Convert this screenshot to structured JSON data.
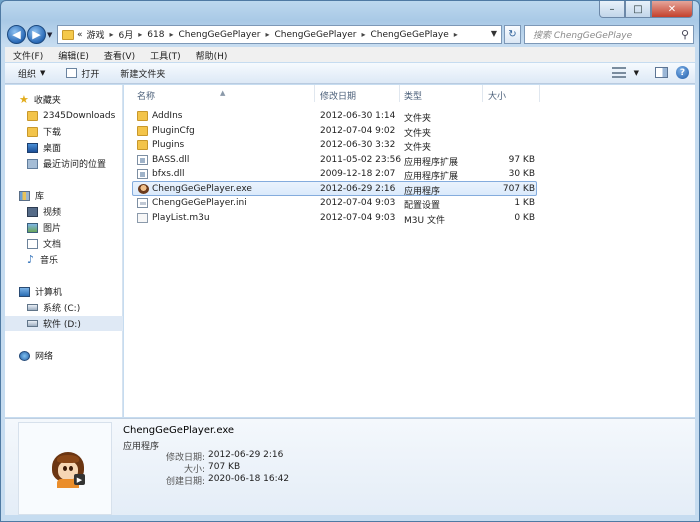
{
  "window": {
    "controls": {
      "minimize": "–",
      "maximize": "□",
      "close": "✕"
    }
  },
  "address": {
    "prefix": "«",
    "crumbs": [
      "游戏",
      "6月",
      "618",
      "ChengGeGePlayer",
      "ChengGeGePlayer",
      "ChengGeGePlaye"
    ],
    "search_placeholder": "搜索 ChengGeGePlaye"
  },
  "menu": [
    "文件(F)",
    "编辑(E)",
    "查看(V)",
    "工具(T)",
    "帮助(H)"
  ],
  "toolbar": {
    "organize": "组织",
    "open": "打开",
    "new_folder": "新建文件夹"
  },
  "nav": {
    "favorites": "收藏夹",
    "fav_items": [
      "2345Downloads",
      "下载",
      "桌面",
      "最近访问的位置"
    ],
    "libraries": "库",
    "lib_items": [
      "视频",
      "图片",
      "文档",
      "音乐"
    ],
    "computer": "计算机",
    "drives": [
      "系统 (C:)",
      "软件 (D:)"
    ],
    "network": "网络"
  },
  "columns": {
    "name": "名称",
    "modified": "修改日期",
    "type": "类型",
    "size": "大小"
  },
  "files": [
    {
      "name": "AddIns",
      "modified": "2012-06-30 1:14",
      "type": "文件夹",
      "size": "",
      "icon": "folder-icon"
    },
    {
      "name": "PluginCfg",
      "modified": "2012-07-04 9:02",
      "type": "文件夹",
      "size": "",
      "icon": "folder-icon"
    },
    {
      "name": "Plugins",
      "modified": "2012-06-30 3:32",
      "type": "文件夹",
      "size": "",
      "icon": "folder-icon"
    },
    {
      "name": "BASS.dll",
      "modified": "2011-05-02 23:56",
      "type": "应用程序扩展",
      "size": "97 KB",
      "icon": "dll-icon"
    },
    {
      "name": "bfxs.dll",
      "modified": "2009-12-18 2:07",
      "type": "应用程序扩展",
      "size": "30 KB",
      "icon": "dll-icon"
    },
    {
      "name": "ChengGeGePlayer.exe",
      "modified": "2012-06-29 2:16",
      "type": "应用程序",
      "size": "707 KB",
      "icon": "exe-icon"
    },
    {
      "name": "ChengGeGePlayer.ini",
      "modified": "2012-07-04 9:03",
      "type": "配置设置",
      "size": "1 KB",
      "icon": "ini-icon"
    },
    {
      "name": "PlayList.m3u",
      "modified": "2012-07-04 9:03",
      "type": "M3U 文件",
      "size": "0 KB",
      "icon": "m3u-icon"
    }
  ],
  "details": {
    "name": "ChengGeGePlayer.exe",
    "type": "应用程序",
    "modified_label": "修改日期:",
    "modified": "2012-06-29 2:16",
    "size_label": "大小:",
    "size": "707 KB",
    "created_label": "创建日期:",
    "created": "2020-06-18 16:42"
  }
}
